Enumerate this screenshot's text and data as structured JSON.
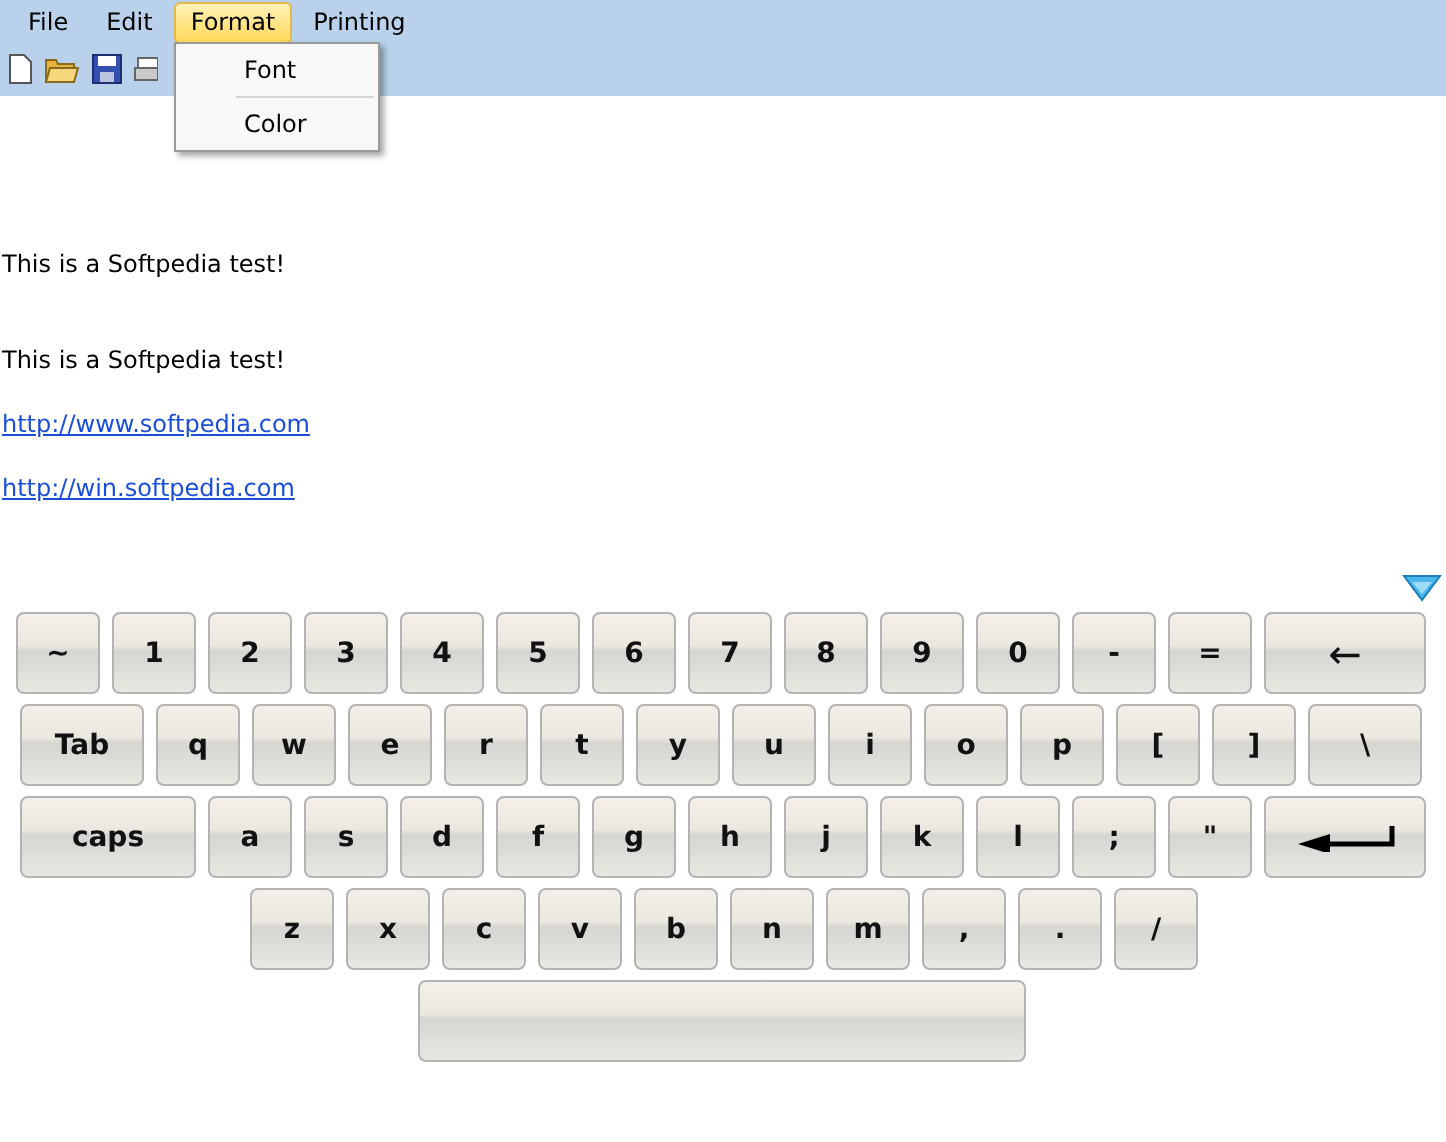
{
  "menu": [
    {
      "label": "File",
      "selected": false
    },
    {
      "label": "Edit",
      "selected": false
    },
    {
      "label": "Format",
      "selected": true
    },
    {
      "label": "Printing",
      "selected": false
    }
  ],
  "dropdown": [
    "Font",
    "Color"
  ],
  "document": [
    {
      "kind": "text",
      "text": "This is a Softpedia test!"
    },
    {
      "kind": "text",
      "text": "This is a Softpedia test!"
    },
    {
      "kind": "link",
      "text": "http://www.softpedia.com"
    },
    {
      "kind": "link",
      "text": "http://win.softpedia.com"
    }
  ],
  "keyboard": [
    [
      {
        "kind": "key",
        "label": "~"
      },
      {
        "kind": "key",
        "label": "1"
      },
      {
        "kind": "key",
        "label": "2"
      },
      {
        "kind": "key",
        "label": "3"
      },
      {
        "kind": "key",
        "label": "4"
      },
      {
        "kind": "key",
        "label": "5"
      },
      {
        "kind": "key",
        "label": "6"
      },
      {
        "kind": "key",
        "label": "7"
      },
      {
        "kind": "key",
        "label": "8"
      },
      {
        "kind": "key",
        "label": "9"
      },
      {
        "kind": "key",
        "label": "0"
      },
      {
        "kind": "key",
        "label": "-"
      },
      {
        "kind": "key",
        "label": "="
      },
      {
        "kind": "backspace",
        "label": "←"
      }
    ],
    [
      {
        "kind": "tab",
        "label": "Tab"
      },
      {
        "kind": "key",
        "label": "q"
      },
      {
        "kind": "key",
        "label": "w"
      },
      {
        "kind": "key",
        "label": "e"
      },
      {
        "kind": "key",
        "label": "r"
      },
      {
        "kind": "key",
        "label": "t"
      },
      {
        "kind": "key",
        "label": "y"
      },
      {
        "kind": "key",
        "label": "u"
      },
      {
        "kind": "key",
        "label": "i"
      },
      {
        "kind": "key",
        "label": "o"
      },
      {
        "kind": "key",
        "label": "p"
      },
      {
        "kind": "key",
        "label": "["
      },
      {
        "kind": "key",
        "label": "]"
      },
      {
        "kind": "backslash",
        "label": "\\"
      }
    ],
    [
      {
        "kind": "caps",
        "label": "caps"
      },
      {
        "kind": "key",
        "label": "a"
      },
      {
        "kind": "key",
        "label": "s"
      },
      {
        "kind": "key",
        "label": "d"
      },
      {
        "kind": "key",
        "label": "f"
      },
      {
        "kind": "key",
        "label": "g"
      },
      {
        "kind": "key",
        "label": "h"
      },
      {
        "kind": "key",
        "label": "j"
      },
      {
        "kind": "key",
        "label": "k"
      },
      {
        "kind": "key",
        "label": "l"
      },
      {
        "kind": "key",
        "label": ";"
      },
      {
        "kind": "key",
        "label": "\""
      },
      {
        "kind": "enter"
      }
    ],
    [
      {
        "kind": "key",
        "label": "z"
      },
      {
        "kind": "key",
        "label": "x"
      },
      {
        "kind": "key",
        "label": "c"
      },
      {
        "kind": "key",
        "label": "v"
      },
      {
        "kind": "key",
        "label": "b"
      },
      {
        "kind": "key",
        "label": "n"
      },
      {
        "kind": "key",
        "label": "m"
      },
      {
        "kind": "key",
        "label": ","
      },
      {
        "kind": "key",
        "label": "."
      },
      {
        "kind": "key",
        "label": "/"
      }
    ],
    [
      {
        "kind": "space"
      }
    ]
  ]
}
